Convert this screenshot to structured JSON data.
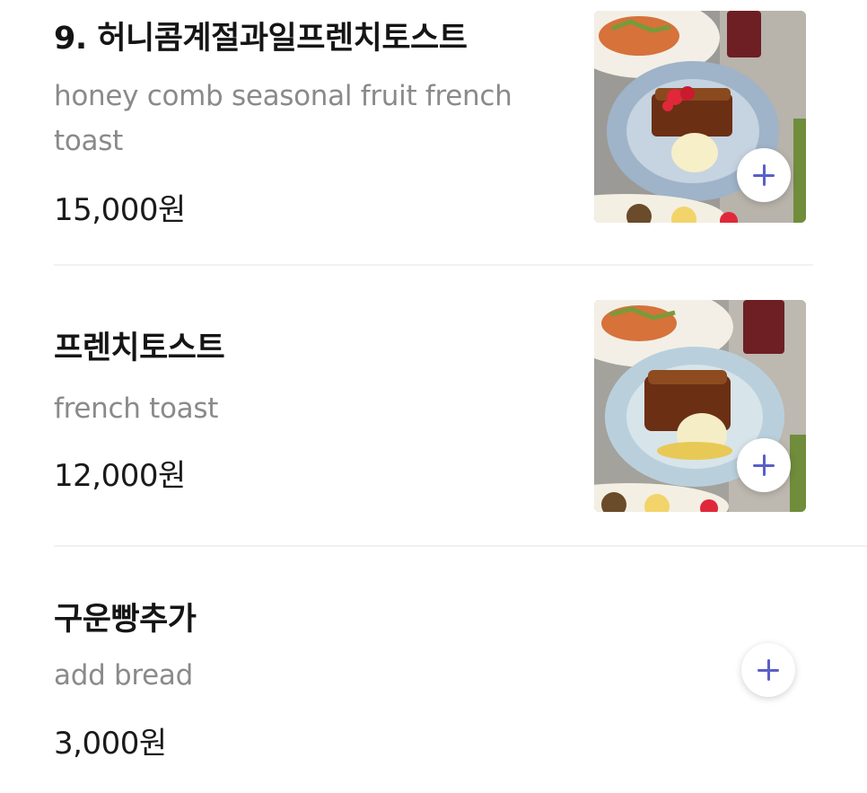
{
  "menu": {
    "items": [
      {
        "name": "9. 허니콤계절과일프렌치토스트",
        "description": "honey comb seasonal fruit french toast",
        "price": "15,000원",
        "has_image": true,
        "image_icon": "food-photo-icon",
        "add_icon": "plus-icon"
      },
      {
        "name": "프렌치토스트",
        "description": "french toast",
        "price": "12,000원",
        "has_image": true,
        "image_icon": "food-photo-icon",
        "add_icon": "plus-icon"
      },
      {
        "name": "구운빵추가",
        "description": "add bread",
        "price": "3,000원",
        "has_image": false,
        "add_icon": "plus-icon"
      }
    ]
  },
  "colors": {
    "accent": "#5b5fc7",
    "title_text": "#151515",
    "secondary_text": "#8a8a8a",
    "divider": "#f1f1f1"
  }
}
